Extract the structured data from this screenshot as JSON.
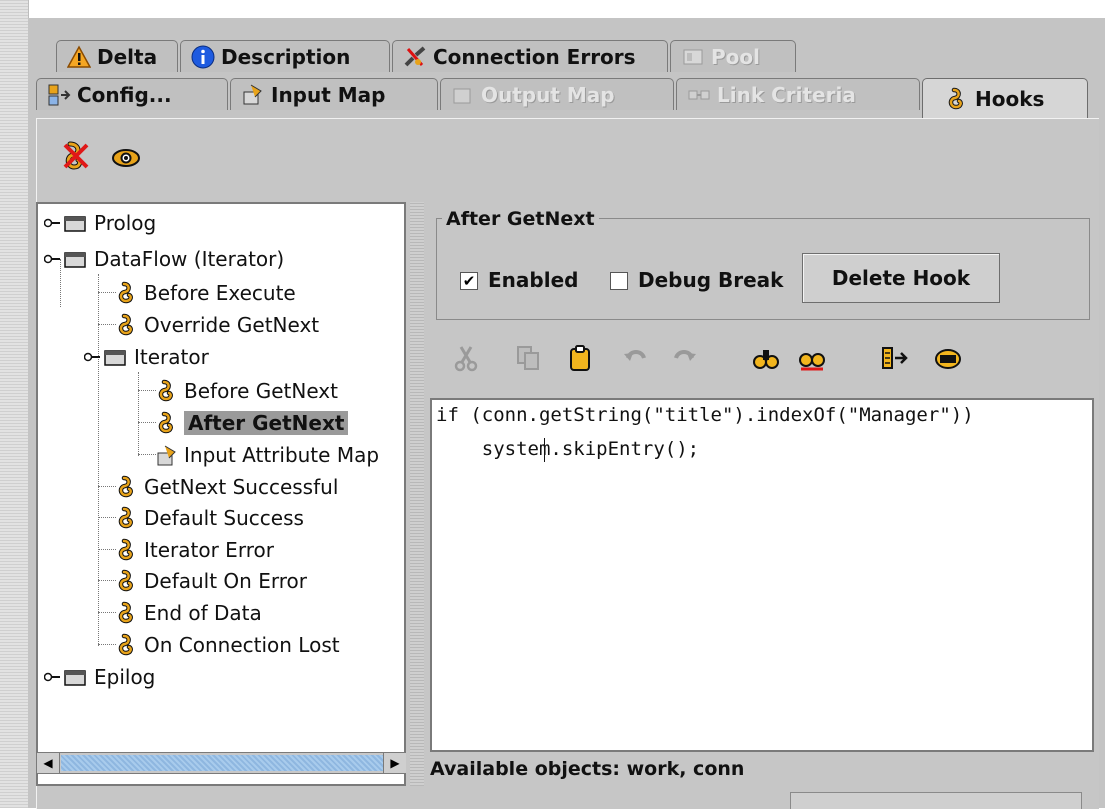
{
  "tabs_row1": [
    {
      "label": "Delta",
      "icon": "warning-icon",
      "disabled": false
    },
    {
      "label": "Description",
      "icon": "info-icon",
      "disabled": false
    },
    {
      "label": "Connection Errors",
      "icon": "broken-link-icon",
      "disabled": false
    },
    {
      "label": "Pool",
      "icon": "pool-icon",
      "disabled": true
    }
  ],
  "tabs_row2": [
    {
      "label": "Config...",
      "icon": "config-icon",
      "disabled": false
    },
    {
      "label": "Input Map",
      "icon": "input-map-icon",
      "disabled": false
    },
    {
      "label": "Output Map",
      "icon": "output-map-icon",
      "disabled": true
    },
    {
      "label": "Link Criteria",
      "icon": "link-criteria-icon",
      "disabled": true
    },
    {
      "label": "Hooks",
      "icon": "hook-icon",
      "disabled": false,
      "active": true
    }
  ],
  "toolbar": {
    "icons": [
      "delete-hook-icon",
      "view-icon"
    ]
  },
  "tree": {
    "nodes": [
      {
        "label": "Prolog",
        "type": "folder",
        "depth": 0
      },
      {
        "label": "DataFlow (Iterator)",
        "type": "folder",
        "depth": 0
      },
      {
        "label": "Before Execute",
        "type": "hook",
        "depth": 1
      },
      {
        "label": "Override GetNext",
        "type": "hook",
        "depth": 1
      },
      {
        "label": "Iterator",
        "type": "folder",
        "depth": 1
      },
      {
        "label": "Before GetNext",
        "type": "hook",
        "depth": 2
      },
      {
        "label": "After GetNext",
        "type": "hook",
        "depth": 2,
        "selected": true
      },
      {
        "label": "Input Attribute Map",
        "type": "map",
        "depth": 2
      },
      {
        "label": "GetNext Successful",
        "type": "hook",
        "depth": 1
      },
      {
        "label": "Default Success",
        "type": "hook",
        "depth": 1
      },
      {
        "label": "Iterator Error",
        "type": "hook",
        "depth": 1
      },
      {
        "label": "Default On Error",
        "type": "hook",
        "depth": 1
      },
      {
        "label": "End of Data",
        "type": "hook",
        "depth": 1
      },
      {
        "label": "On Connection Lost",
        "type": "hook",
        "depth": 1
      },
      {
        "label": "Epilog",
        "type": "folder",
        "depth": 0
      }
    ]
  },
  "hook_panel": {
    "title": "After GetNext",
    "enabled_label": "Enabled",
    "enabled": true,
    "debug_label": "Debug Break",
    "debug": false,
    "delete_label": "Delete Hook"
  },
  "editor_toolbar": [
    "cut-icon",
    "copy-icon",
    "paste-icon",
    "undo-icon",
    "redo-icon",
    "find-icon",
    "find-replace-icon",
    "goto-line-icon",
    "edit-icon"
  ],
  "editor": {
    "line1": "if (conn.getString(\"title\").indexOf(\"Manager\"))",
    "line2": "    system.skipEntry();"
  },
  "status": "Available objects: work, conn",
  "colors": {
    "panel": "#c6c6c6",
    "selection": "#9a9a9a",
    "hook_orange": "#e8a31a"
  }
}
